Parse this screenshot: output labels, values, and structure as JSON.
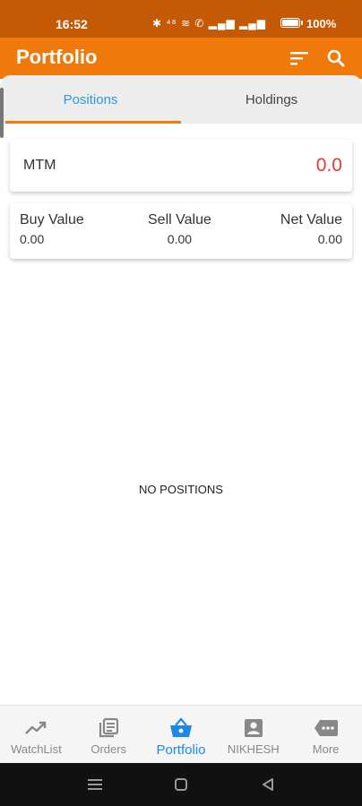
{
  "status_bar": {
    "time": "16:52",
    "icons_text": "✱ ⁴⁸ ≋ ✆ ▂▄▆ ▂▄▆",
    "battery_percent": 100,
    "battery_label": "100%"
  },
  "app_bar": {
    "title": "Portfolio",
    "filter_icon": "filter-icon",
    "search_icon": "search-icon",
    "background_color": "#ef7a0b"
  },
  "tabs": [
    {
      "label": "Positions",
      "active": true
    },
    {
      "label": "Holdings",
      "active": false
    }
  ],
  "mtm": {
    "label": "MTM",
    "value": "0.0",
    "value_color": "#e53935"
  },
  "values": {
    "buy_label": "Buy Value",
    "buy_value": "0.00",
    "sell_label": "Sell Value",
    "sell_value": "0.00",
    "net_label": "Net Value",
    "net_value": "0.00"
  },
  "empty_message": "NO POSITIONS",
  "bottom_nav": [
    {
      "label": "WatchList",
      "icon": "trending-up-icon",
      "active": false
    },
    {
      "label": "Orders",
      "icon": "orders-icon",
      "active": false
    },
    {
      "label": "Portfolio",
      "icon": "basket-icon",
      "active": true
    },
    {
      "label": "NIKHESH",
      "icon": "account-icon",
      "active": false
    },
    {
      "label": "More",
      "icon": "more-icon",
      "active": false
    }
  ],
  "accent_colors": {
    "active_tab_text": "#2f97e0",
    "active_nav": "#1e88e5",
    "tab_indicator": "#ef7a0b"
  }
}
